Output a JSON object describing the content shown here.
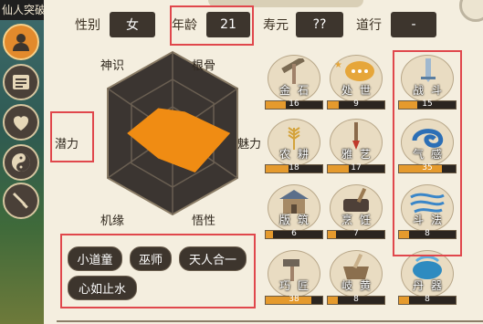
{
  "window": {
    "title_fragment": "仙人突破"
  },
  "sidebar": {
    "items": [
      {
        "name": "character"
      },
      {
        "name": "messages"
      },
      {
        "name": "heart"
      },
      {
        "name": "yin-yang"
      },
      {
        "name": "sword"
      }
    ]
  },
  "stats": {
    "gender_label": "性别",
    "gender_value": "女",
    "age_label": "年龄",
    "age_value": "21",
    "lifespan_label": "寿元",
    "lifespan_value": "??",
    "dao_label": "道行",
    "dao_value": "-"
  },
  "attributes": {
    "labels": [
      "神识",
      "根骨",
      "魅力",
      "悟性",
      "机缘",
      "潜力"
    ],
    "values": [
      0.35,
      0.3,
      0.7,
      0.55,
      0.35,
      0.55
    ]
  },
  "traits": [
    "小道童",
    "巫师",
    "天人合一",
    "心如止水"
  ],
  "skills": [
    {
      "name": "金石",
      "value": "16",
      "fill": 0.35
    },
    {
      "name": "处世",
      "value": "9",
      "fill": 0.2
    },
    {
      "name": "战斗",
      "value": "15",
      "fill": 0.33
    },
    {
      "name": "农耕",
      "value": "18",
      "fill": 0.4
    },
    {
      "name": "雅艺",
      "value": "17",
      "fill": 0.37
    },
    {
      "name": "气感",
      "value": "35",
      "fill": 0.75
    },
    {
      "name": "版筑",
      "value": "6",
      "fill": 0.13
    },
    {
      "name": "烹饪",
      "value": "7",
      "fill": 0.15
    },
    {
      "name": "斗法",
      "value": "8",
      "fill": 0.18
    },
    {
      "name": "巧匠",
      "value": "38",
      "fill": 0.8
    },
    {
      "name": "岐黄",
      "value": "8",
      "fill": 0.18
    },
    {
      "name": "丹器",
      "value": "8",
      "fill": 0.18
    }
  ],
  "colors": {
    "accent": "#e59a2d",
    "highlight": "#e0474c",
    "dark": "#3d352d"
  }
}
